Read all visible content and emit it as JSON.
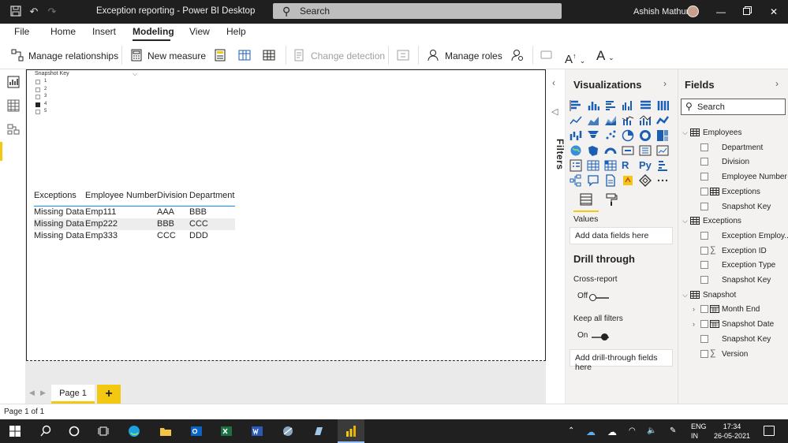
{
  "window": {
    "title": "Exception reporting - Power BI Desktop",
    "search_placeholder": "Search",
    "user": "Ashish Mathur"
  },
  "menu": {
    "items": [
      "File",
      "Home",
      "Insert",
      "Modeling",
      "View",
      "Help"
    ],
    "active": "Modeling"
  },
  "ribbon": {
    "manage_relationships": "Manage relationships",
    "new_measure": "New measure",
    "change_detection": "Change detection",
    "manage_roles": "Manage roles"
  },
  "slicer": {
    "title": "Snapshot Key",
    "options": [
      {
        "label": "1",
        "checked": false
      },
      {
        "label": "2",
        "checked": false
      },
      {
        "label": "3",
        "checked": false
      },
      {
        "label": "4",
        "checked": true
      },
      {
        "label": "5",
        "checked": false
      }
    ]
  },
  "table": {
    "columns": [
      "Exceptions",
      "Employee Number",
      "Division",
      "Department"
    ],
    "rows": [
      [
        "Missing Data",
        "Emp111",
        "AAA",
        "BBB"
      ],
      [
        "Missing Data",
        "Emp222",
        "BBB",
        "CCC"
      ],
      [
        "Missing Data",
        "Emp333",
        "CCC",
        "DDD"
      ]
    ]
  },
  "pages": {
    "tabs": [
      "Page 1"
    ],
    "add_label": "+"
  },
  "filters": {
    "label": "Filters"
  },
  "visualizations": {
    "title": "Visualizations",
    "values_label": "Values",
    "values_placeholder": "Add data fields here",
    "drill_title": "Drill through",
    "cross_report_label": "Cross-report",
    "cross_report_state": "Off",
    "keep_filters_label": "Keep all filters",
    "keep_filters_state": "On",
    "drill_placeholder": "Add drill-through fields here",
    "r_label": "R",
    "py_label": "Py"
  },
  "fields": {
    "title": "Fields",
    "search_placeholder": "Search",
    "tables": [
      {
        "name": "Employees",
        "fields": [
          "Department",
          "Division",
          "Employee Number",
          "Exceptions",
          "Snapshot Key"
        ]
      },
      {
        "name": "Exceptions",
        "fields": [
          "Exception Employ...",
          "Exception ID",
          "Exception Type",
          "Snapshot Key"
        ]
      },
      {
        "name": "Snapshot",
        "fields": [
          "Month End",
          "Snapshot Date",
          "Snapshot Key",
          "Version"
        ]
      }
    ]
  },
  "status": {
    "page_info": "Page 1 of 1"
  },
  "taskbar": {
    "lang_line1": "ENG",
    "lang_line2": "IN",
    "time": "17:34",
    "date": "26-05-2021"
  },
  "colors": {
    "accent": "#f2c811",
    "table_header_line": "#118dff",
    "titlebar": "#1f1f1f",
    "taskbar": "#202020"
  }
}
